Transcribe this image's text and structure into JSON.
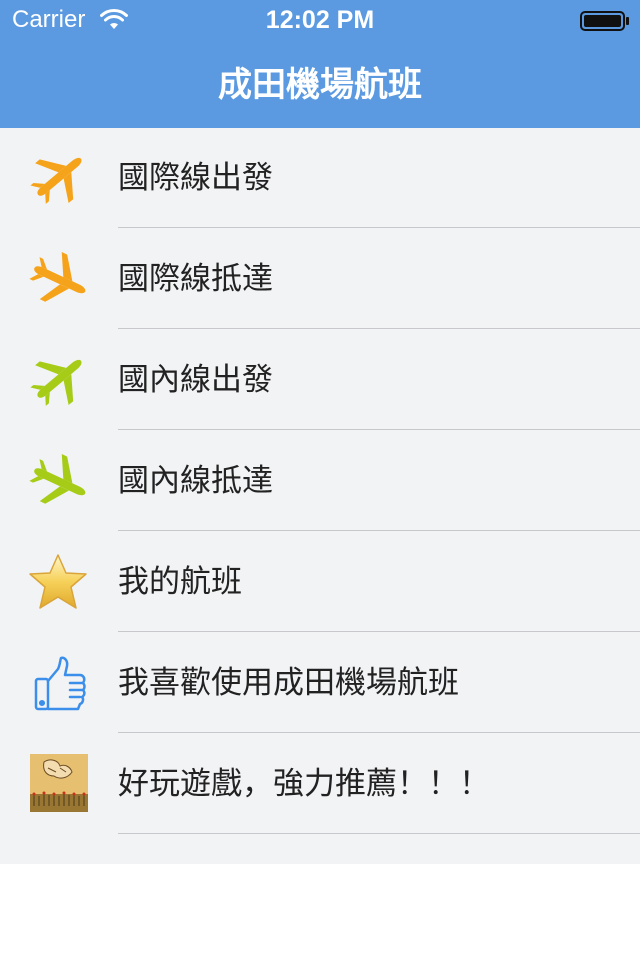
{
  "status_bar": {
    "carrier": "Carrier",
    "time": "12:02 PM",
    "wifi_icon": "wifi-icon",
    "battery_icon": "battery-icon"
  },
  "nav": {
    "title": "成田機場航班"
  },
  "menu": {
    "items": [
      {
        "label": "國際線出發",
        "icon": "plane-departure-icon",
        "color": "#f5a31a"
      },
      {
        "label": "國際線抵達",
        "icon": "plane-arrival-icon",
        "color": "#f5a31a"
      },
      {
        "label": "國內線出發",
        "icon": "plane-departure-icon",
        "color": "#a6cc18"
      },
      {
        "label": "國內線抵達",
        "icon": "plane-arrival-icon",
        "color": "#a6cc18"
      },
      {
        "label": "我的航班",
        "icon": "star-icon",
        "color": "#f6d15a"
      },
      {
        "label": "我喜歡使用成田機場航班",
        "icon": "thumbs-up-icon",
        "color": "#3b8eea"
      },
      {
        "label": "好玩遊戲，強力推薦！！！",
        "icon": "game-thumbnail-icon",
        "color": "#dcb25c"
      }
    ]
  },
  "colors": {
    "header_bg": "#5b9ae0",
    "list_bg": "#f2f3f5",
    "divider": "#c8c8cc"
  }
}
